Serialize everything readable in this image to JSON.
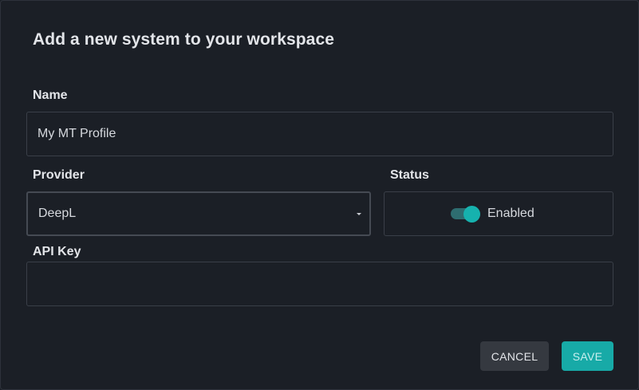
{
  "dialog": {
    "title": "Add a new system to your workspace"
  },
  "form": {
    "name": {
      "label": "Name",
      "value": "My MT Profile"
    },
    "provider": {
      "label": "Provider",
      "selected": "DeepL"
    },
    "status": {
      "label": "Status",
      "toggle_label": "Enabled",
      "enabled": true
    },
    "api_key": {
      "label": "API Key",
      "value": ""
    }
  },
  "actions": {
    "cancel_label": "CANCEL",
    "save_label": "SAVE"
  },
  "colors": {
    "background": "#1b1f26",
    "accent": "#17aaa7",
    "toggle_track": "#2e6d70",
    "cancel_button": "#353940"
  }
}
